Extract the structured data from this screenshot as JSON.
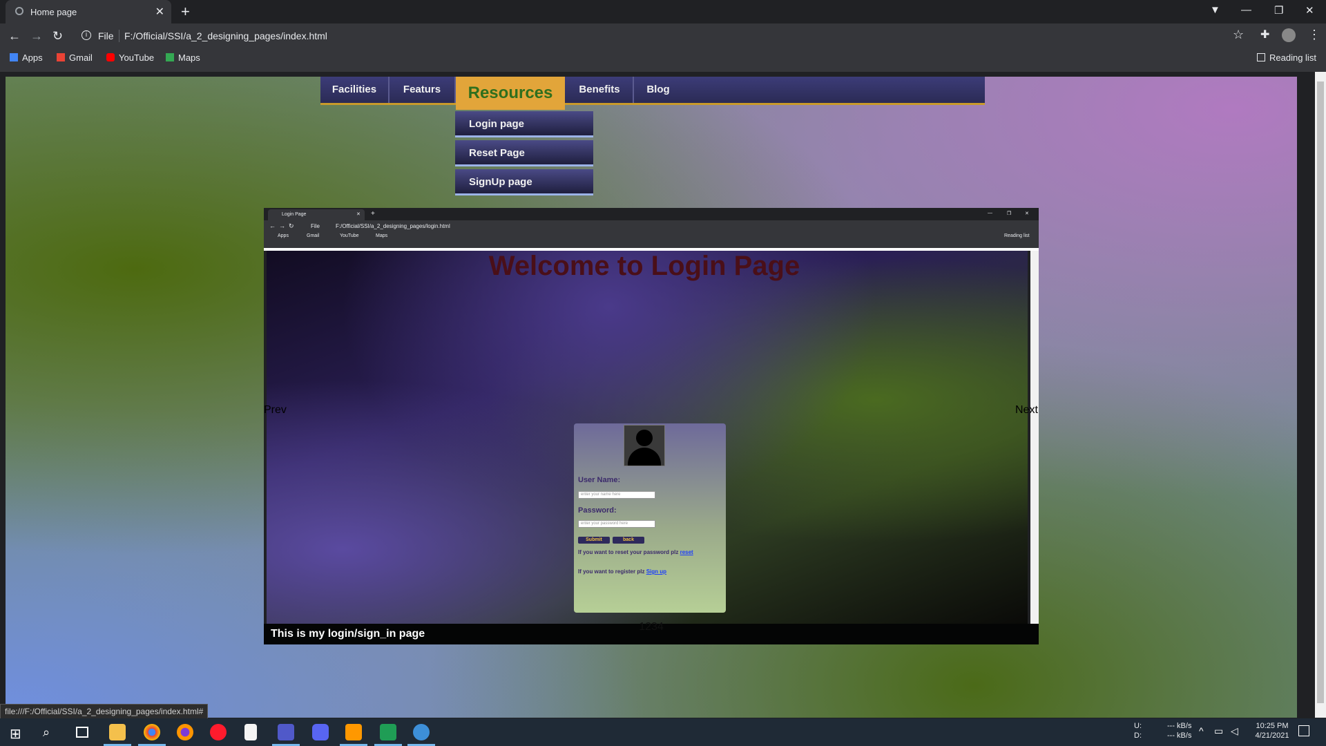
{
  "browser": {
    "tab_title": "Home page",
    "address_prefix": "File",
    "url": "F:/Official/SSI/a_2_designing_pages/index.html",
    "bookmarks": [
      "Apps",
      "Gmail",
      "YouTube",
      "Maps"
    ],
    "reading_list": "Reading list",
    "status_url": "file:///F:/Official/SSI/a_2_designing_pages/index.html#"
  },
  "nav": {
    "items": [
      "Facilities",
      "Featurs",
      "Resources",
      "Benefits",
      "Blog"
    ],
    "active": "Resources",
    "dropdown": [
      "Login page",
      "Reset Page",
      "SignUp page"
    ]
  },
  "slideshow": {
    "prev": "Prev",
    "next": "Next",
    "caption": "This is my login/sign_in page",
    "dots": "1234",
    "screenshot": {
      "tab_title": "Login Page",
      "address_prefix": "File",
      "url": "F:/Official/SSI/a_2_designing_pages/login.html",
      "bookmarks": [
        "Apps",
        "Gmail",
        "YouTube",
        "Maps"
      ],
      "reading_list": "Reading list",
      "heading": "Welcome to  Login Page",
      "username_label": "User Name:",
      "username_placeholder": "enter your name here",
      "password_label": "Password:",
      "password_placeholder": "enter your password here",
      "submit": "Submit",
      "back": "back",
      "reset_text": "If you want to reset your password plz",
      "reset_link": "reset",
      "register_text": "If you want to register plz",
      "register_link": "Sign up"
    }
  },
  "taskbar": {
    "net_up_label": "U:",
    "net_down_label": "D:",
    "net_up": "--- kB/s",
    "net_down": "--- kB/s",
    "time": "10:25 PM",
    "date": "4/21/2021"
  },
  "colors": {
    "nav_bg": "#2b2b55",
    "nav_active": "#e2a53a",
    "nav_active_text": "#2f6f1e",
    "welcome_text": "#4a0f18"
  }
}
